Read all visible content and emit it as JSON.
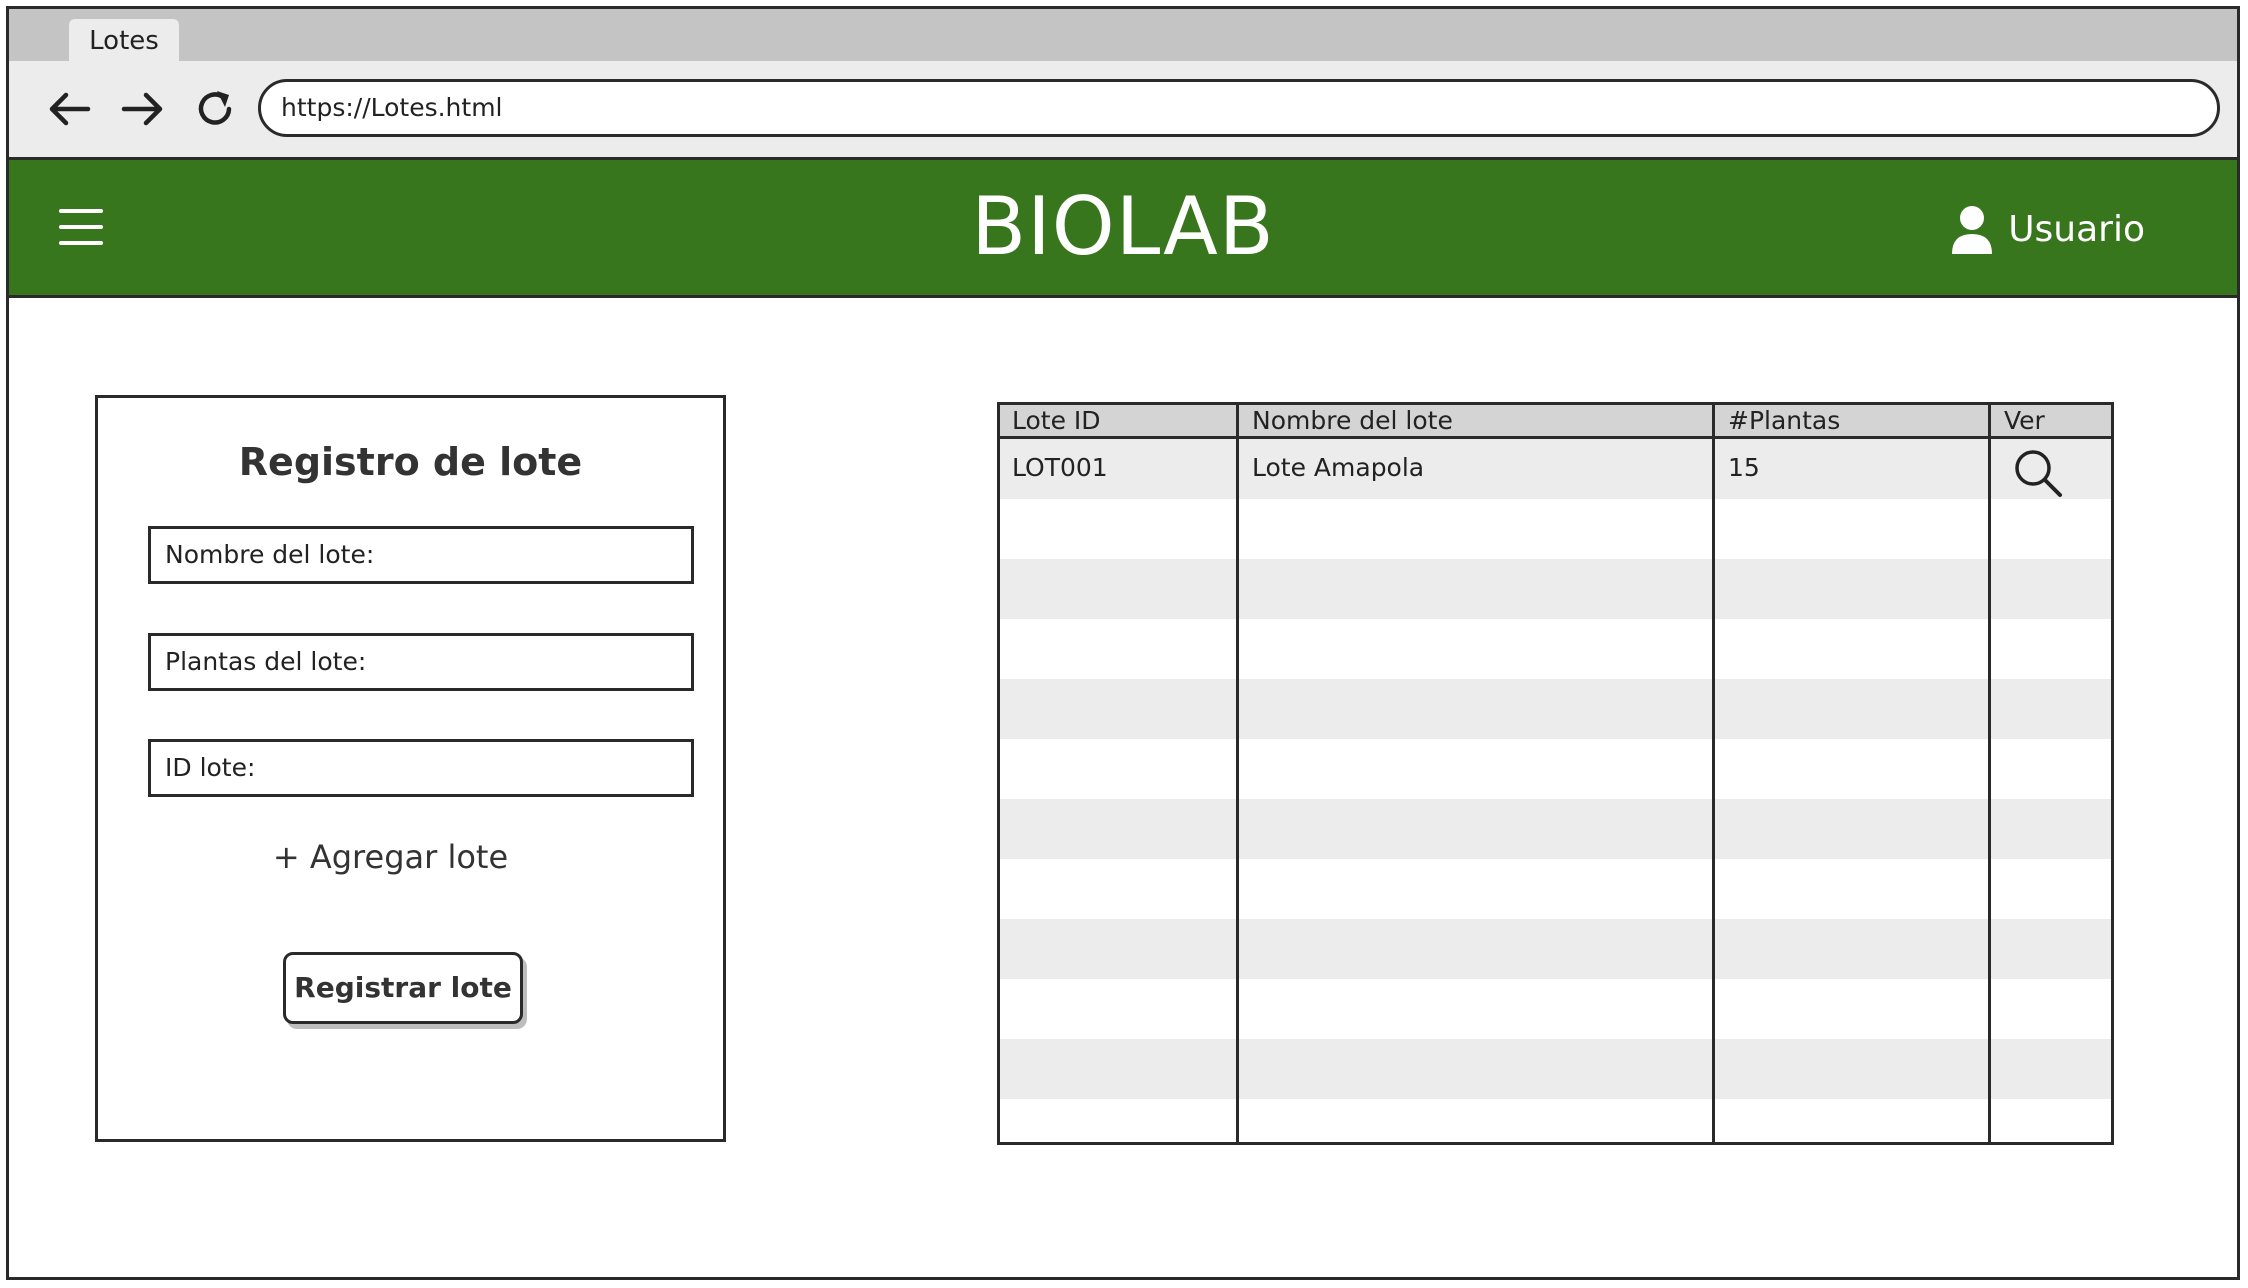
{
  "browser": {
    "tab_title": "Lotes",
    "url": "https://Lotes.html",
    "icons": [
      "back-arrow-icon",
      "forward-arrow-icon",
      "reload-icon"
    ]
  },
  "header": {
    "brand": "BIOLAB",
    "user_label": "Usuario",
    "background_color": "#38761d",
    "icons": [
      "hamburger-menu-icon",
      "user-icon"
    ]
  },
  "form": {
    "title": "Registro de lote",
    "fields": [
      {
        "label": "Nombre del lote:"
      },
      {
        "label": "Plantas del lote:"
      },
      {
        "label": "ID lote:"
      }
    ],
    "add_link": "+ Agregar lote",
    "submit_label": "Registrar lote"
  },
  "table": {
    "columns": [
      "Lote ID",
      "Nombre del lote",
      "#Plantas",
      "Ver"
    ],
    "rows": [
      {
        "id": "LOT001",
        "name": "Lote Amapola",
        "plants": "15",
        "view_icon": "search-icon"
      }
    ]
  }
}
